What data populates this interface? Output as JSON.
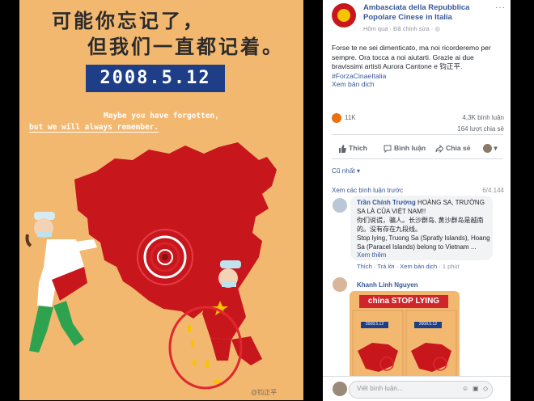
{
  "poster": {
    "headline_line1": "可能你忘记了，",
    "headline_line2": "但我们一直都记着。",
    "date": "2008.5.12",
    "english_line1": "Maybe you have forgotten,",
    "english_line2": "but we will always remember.",
    "watermark": "@钧正平"
  },
  "post": {
    "page_name": "Ambasciata della Repubblica Popolare Cinese in Italia",
    "meta": "Hôm qua · Đã chỉnh sửa · ",
    "caption": "Forse te ne sei dimenticato, ma noi ricorderemo per sempre. Ora tocca a noi aiutarti. Grazie ai due bravissimi artisti Aurora Cantone e 钧正平.",
    "hashtag": "#ForzaCinaeItalia",
    "translate": "Xem bản dịch",
    "more": "···",
    "reactions_count": "11K",
    "comments_count": "4,3K bình luận",
    "shares_count": "164 lượt chia sẻ"
  },
  "actions": {
    "like": "Thích",
    "comment": "Bình luận",
    "share": "Chia sẻ"
  },
  "comments_section": {
    "sort": "Cũ nhất ▾",
    "view_previous": "Xem các bình luận trước",
    "count": "6/4.144"
  },
  "comment1": {
    "name": "Trần Chính Trường",
    "text_inline": " HOÀNG SA, TRƯỜNG SA LÀ CỦA VIỆT NAM!!",
    "text_cn": "你们说谎，骗人。长沙群岛, 黄沙群岛是越南的。没有存在九段线。",
    "text_en": "Stop lying, Truong Sa (Spratly Islands), Hoang Sa (Paracel Islands) belong to Vietnam ... ",
    "see_more": "Xem thêm",
    "like": "Thích",
    "reply": "Trả lời",
    "translate": "Xem bản dịch",
    "time": "1 phút"
  },
  "comment2": {
    "name": "Khanh Linh Nguyen",
    "image_banner": "china STOP LYING",
    "image_date": "2008.5.12"
  },
  "composer": {
    "placeholder": "Viết bình luận..."
  },
  "colors": {
    "poster_bg": "#f3b870",
    "map_red": "#c8161d",
    "date_box": "#1e3e87",
    "link_blue": "#385898",
    "target_ring": "#d8232a"
  }
}
